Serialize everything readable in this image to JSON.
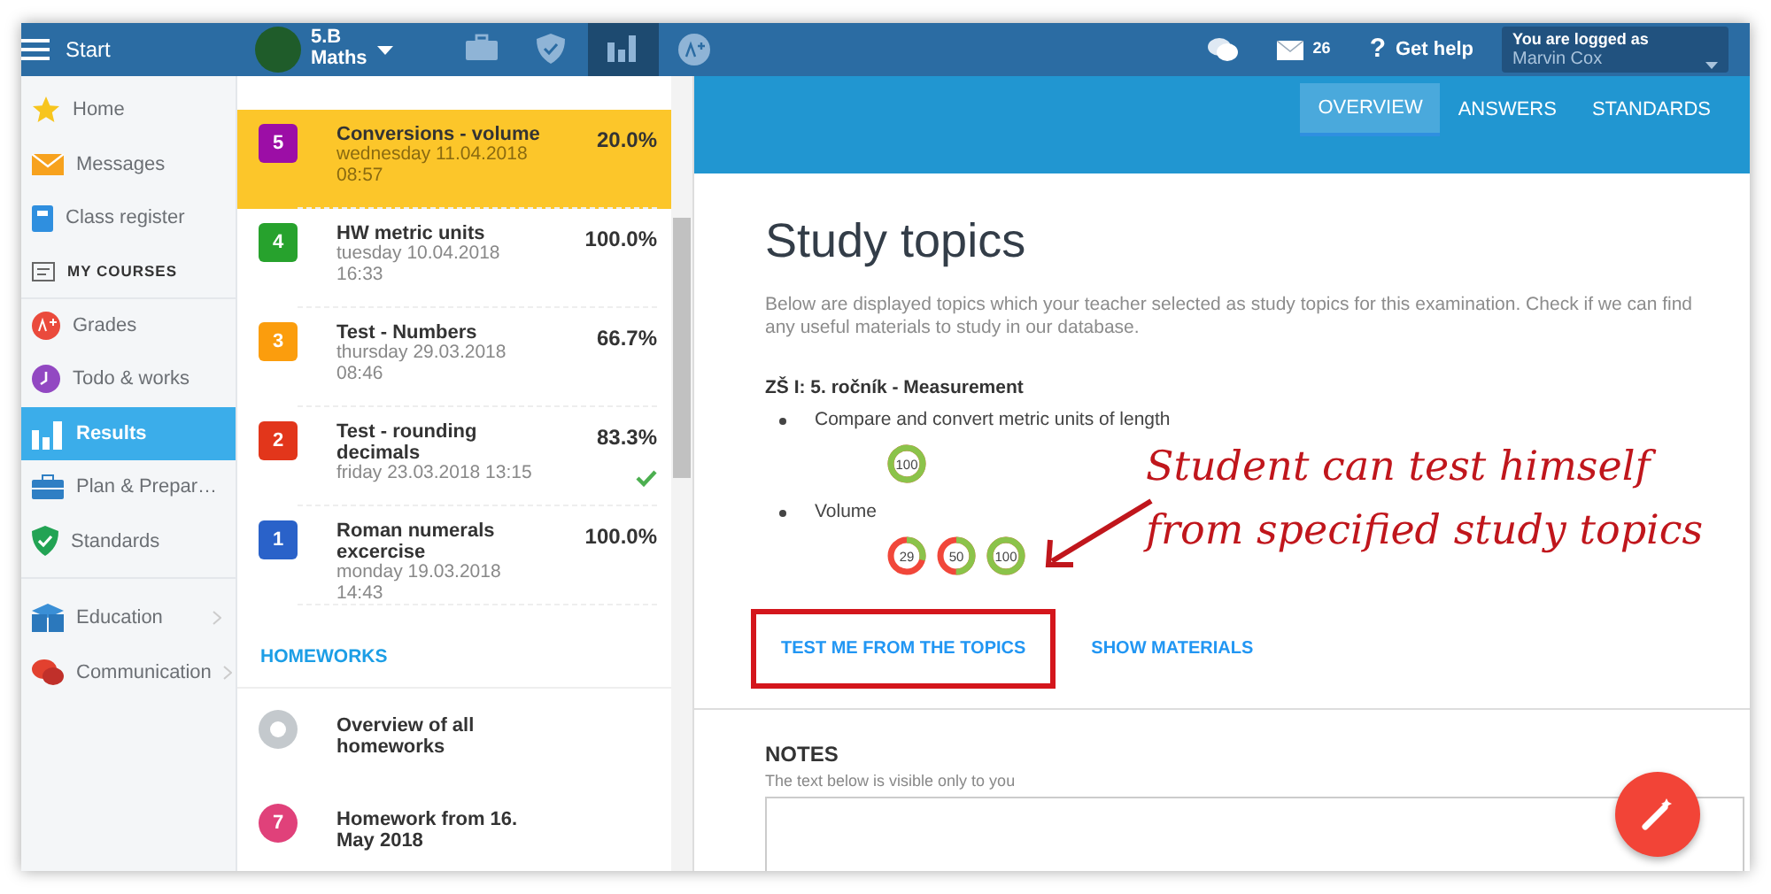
{
  "topbar": {
    "start_label": "Start",
    "course": {
      "class": "5.B",
      "subject": "Maths"
    },
    "toolbar": [
      {
        "kind": "briefcase",
        "selected": false
      },
      {
        "kind": "shield",
        "selected": false
      },
      {
        "kind": "chart",
        "selected": true
      },
      {
        "kind": "grade",
        "selected": false
      }
    ],
    "messages_count": "26",
    "help_label": "Get help",
    "help_glyph": "?",
    "user": {
      "caption": "You are logged as",
      "name": "Marvin Cox"
    }
  },
  "sidebar": {
    "items": [
      {
        "kind": "item",
        "label": "Home",
        "selected": false
      },
      {
        "kind": "item",
        "label": "Messages",
        "selected": false
      },
      {
        "kind": "item",
        "label": "Class register",
        "selected": false
      },
      {
        "kind": "heading",
        "label": "MY COURSES"
      },
      {
        "kind": "item",
        "label": "Grades",
        "selected": false
      },
      {
        "kind": "item",
        "label": "Todo & works",
        "selected": false
      },
      {
        "kind": "item",
        "label": "Results",
        "selected": true
      },
      {
        "kind": "item",
        "label": "Plan & Prepar…",
        "selected": false
      },
      {
        "kind": "item",
        "label": "Standards",
        "selected": false
      },
      {
        "kind": "divider"
      },
      {
        "kind": "group",
        "label": "Education"
      },
      {
        "kind": "group",
        "label": "Communication"
      }
    ]
  },
  "tests": [
    {
      "number": "5",
      "color": "#9c0ea6",
      "title": "Conversions - volume",
      "date": "wednesday 11.04.2018 08:57",
      "score": "20.0%",
      "selected": true,
      "checked": false
    },
    {
      "number": "4",
      "color": "#27a22d",
      "title": "HW metric units",
      "date": "tuesday 10.04.2018 16:33",
      "score": "100.0%",
      "selected": false,
      "checked": false
    },
    {
      "number": "3",
      "color": "#fb9d0d",
      "title": "Test - Numbers",
      "date": "thursday 29.03.2018 08:46",
      "score": "66.7%",
      "selected": false,
      "checked": false
    },
    {
      "number": "2",
      "color": "#e2361b",
      "title": "Test - rounding decimals",
      "date": "friday 23.03.2018 13:15",
      "score": "83.3%",
      "selected": false,
      "checked": true
    },
    {
      "number": "1",
      "color": "#2a62c9",
      "title": "Roman numerals excercise",
      "date": "monday 19.03.2018 14:43",
      "score": "100.0%",
      "selected": false,
      "checked": false
    }
  ],
  "homeworks": {
    "heading": "HOMEWORKS",
    "items": [
      {
        "kind": "overview",
        "title": "Overview of all homeworks"
      },
      {
        "kind": "numbered",
        "number": "7",
        "color": "#e0417a",
        "title": "Homework from 16. May 2018"
      }
    ]
  },
  "tabs": [
    {
      "label": "OVERVIEW",
      "selected": true
    },
    {
      "label": "ANSWERS",
      "selected": false
    },
    {
      "label": "STANDARDS",
      "selected": false
    }
  ],
  "content": {
    "title": "Study topics",
    "description": "Below are displayed topics which your teacher selected as study topics for this examination. Check if we can find any useful materials to study in our database.",
    "subject": "ZŠ I: 5. ročník - Measurement",
    "topics": [
      {
        "name": "Compare and convert metric units of length",
        "rings": [
          {
            "value": "100",
            "level": 1
          }
        ]
      },
      {
        "name": "Volume",
        "rings": [
          {
            "value": "29",
            "level": 0.29
          },
          {
            "value": "50",
            "level": 0.5
          },
          {
            "value": "100",
            "level": 1
          }
        ]
      }
    ],
    "actions": [
      {
        "label": "TEST ME FROM THE TOPICS",
        "highlighted": true
      },
      {
        "label": "SHOW MATERIALS",
        "highlighted": false
      }
    ]
  },
  "notes": {
    "heading": "NOTES",
    "hint": "The text below is visible only to you"
  },
  "annotation": {
    "lines": [
      "Student can test himself",
      "from specified study topics"
    ]
  }
}
